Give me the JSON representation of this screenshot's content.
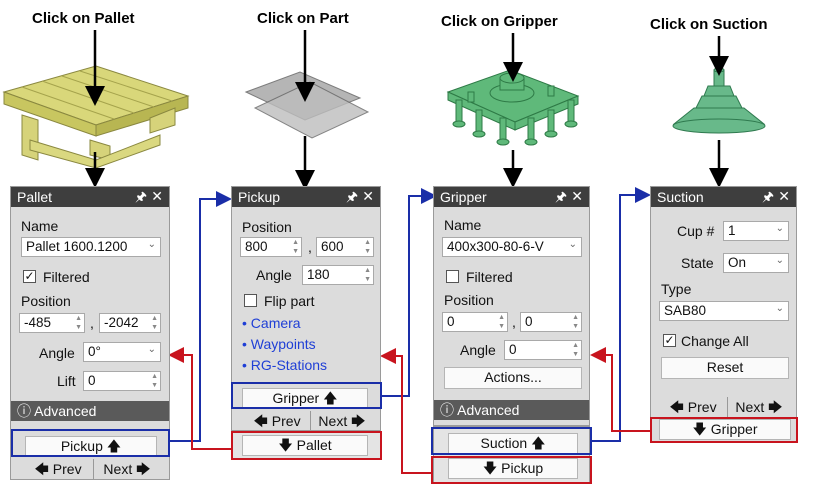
{
  "captions": {
    "pallet": "Click on Pallet",
    "part": "Click on Part",
    "gripper": "Click on Gripper",
    "suction": "Click on Suction"
  },
  "icons": {
    "pin": "pin-icon",
    "close": "close-icon",
    "advanced": "chevron-circle-icon"
  },
  "colors": {
    "blue_highlight": "#1a2ea8",
    "red_highlight": "#c8141e",
    "link": "#1f3fd6",
    "panel_header": "#3e3e3e"
  },
  "pallet_panel": {
    "title": "Pallet",
    "name_label": "Name",
    "name_value": "Pallet 1600.1200",
    "filtered_label": "Filtered",
    "filtered_checked": true,
    "position_label": "Position",
    "pos_x": "-485",
    "pos_y": "-2042",
    "angle_label": "Angle",
    "angle_value": "0°",
    "lift_label": "Lift",
    "lift_value": "0",
    "advanced_label": "Advanced",
    "next_step": "Pickup",
    "prev": "Prev",
    "next": "Next"
  },
  "pickup_panel": {
    "title": "Pickup",
    "position_label": "Position",
    "pos_x": "800",
    "pos_y": "600",
    "angle_label": "Angle",
    "angle_value": "180",
    "flip_label": "Flip part",
    "flip_checked": false,
    "links": [
      "• Camera",
      "• Waypoints",
      "• RG-Stations"
    ],
    "next_step": "Gripper",
    "prev": "Prev",
    "next": "Next",
    "back_step": "Pallet"
  },
  "gripper_panel": {
    "title": "Gripper",
    "name_label": "Name",
    "name_value": "400x300-80-6-V",
    "filtered_label": "Filtered",
    "filtered_checked": false,
    "position_label": "Position",
    "pos_x": "0",
    "pos_y": "0",
    "angle_label": "Angle",
    "angle_value": "0",
    "actions_label": "Actions...",
    "advanced_label": "Advanced",
    "next_step": "Suction",
    "back_step": "Pickup"
  },
  "suction_panel": {
    "title": "Suction",
    "cup_label": "Cup #",
    "cup_value": "1",
    "state_label": "State",
    "state_value": "On",
    "type_label": "Type",
    "type_value": "SAB80",
    "change_all_label": "Change All",
    "change_all_checked": true,
    "reset_label": "Reset",
    "prev": "Prev",
    "next": "Next",
    "back_step": "Gripper"
  }
}
